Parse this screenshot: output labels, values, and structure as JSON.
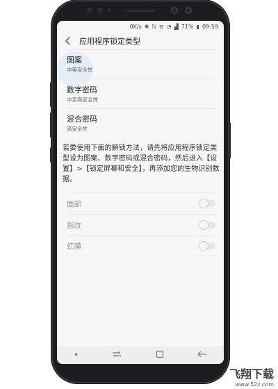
{
  "status_bar": {
    "speed": "0K/s",
    "battery": "71%",
    "time": "09:59",
    "icons": [
      "bluetooth-icon",
      "nfc-icon",
      "mute-icon",
      "wifi-icon",
      "signal-icon",
      "battery-icon"
    ]
  },
  "header": {
    "back_icon": "chevron-left-icon",
    "title": "应用程序锁定类型"
  },
  "lock_types": [
    {
      "name": "图案",
      "desc": "中等安全性"
    },
    {
      "name": "数字密码",
      "desc": "中至高安全性"
    },
    {
      "name": "混合密码",
      "desc": "高安全性"
    }
  ],
  "description": "若要使用下面的解锁方法，请先将应用程序锁定类型设为图案、数字密码或混合密码，然后进入【设置】>【锁定屏幕和安全】，再添加您的生物识别数据。",
  "biometrics": [
    {
      "name": "面部",
      "enabled": false
    },
    {
      "name": "指纹",
      "enabled": false
    },
    {
      "name": "虹膜",
      "enabled": false
    }
  ],
  "nav_bar": {
    "dot": "•",
    "recent": "⮐",
    "home": "▢",
    "back": "←"
  },
  "watermark": {
    "brand": "飞翔下载",
    "url": "www.52z.com"
  }
}
